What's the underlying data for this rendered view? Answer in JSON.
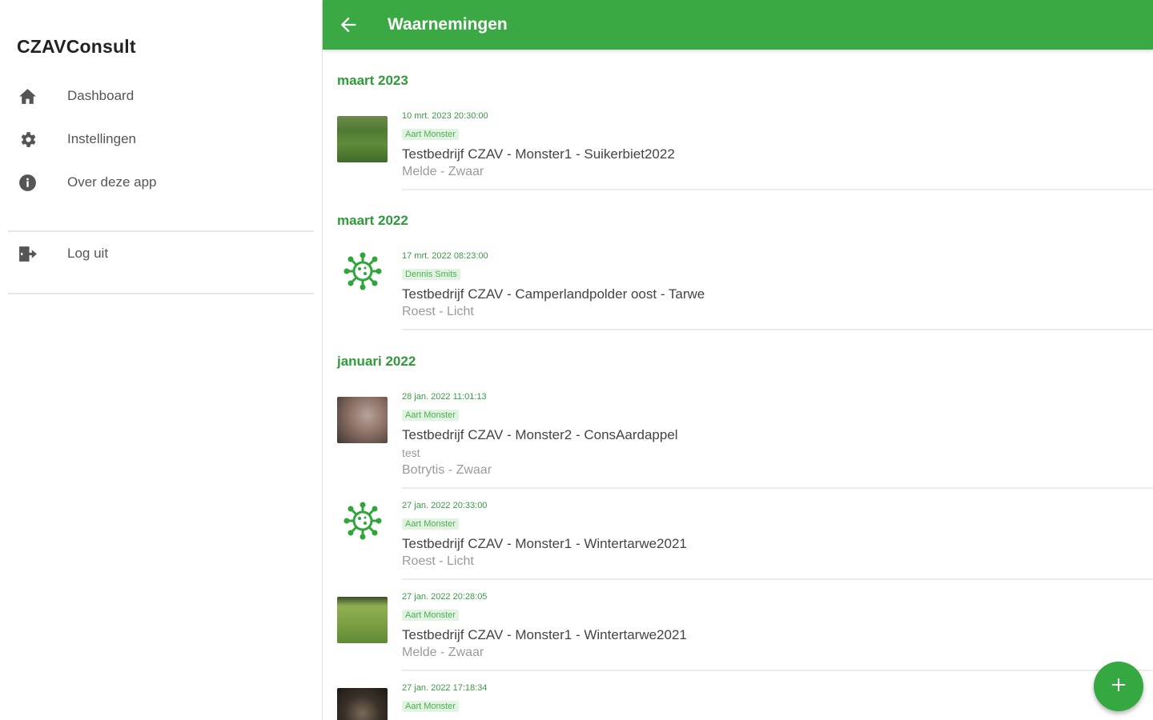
{
  "app": {
    "title": "CZAVConsult"
  },
  "sidebar": {
    "items": [
      {
        "label": "Dashboard",
        "icon": "home-icon"
      },
      {
        "label": "Instellingen",
        "icon": "gear-icon"
      },
      {
        "label": "Over deze app",
        "icon": "info-icon"
      }
    ],
    "logout": {
      "label": "Log uit",
      "icon": "logout-icon"
    }
  },
  "header": {
    "title": "Waarnemingen"
  },
  "sections": [
    {
      "heading": "maart 2023",
      "items": [
        {
          "date": "10 mrt. 2023 20:30:00",
          "author": "Aart Monster",
          "title": "Testbedrijf CZAV - Monster1 - Suikerbiet2022",
          "detail": "Melde - Zwaar",
          "thumb": "photo"
        }
      ]
    },
    {
      "heading": "maart 2022",
      "items": [
        {
          "date": "17 mrt. 2022 08:23:00",
          "author": "Dennis Smits",
          "title": "Testbedrijf CZAV - Camperlandpolder oost - Tarwe",
          "detail": "Roest - Licht",
          "thumb": "virus-icon"
        }
      ]
    },
    {
      "heading": "januari 2022",
      "items": [
        {
          "date": "28 jan. 2022 11:01:13",
          "author": "Aart Monster",
          "title": "Testbedrijf CZAV - Monster2 - ConsAardappel",
          "note": "test",
          "detail": "Botrytis - Zwaar",
          "thumb": "photo"
        },
        {
          "date": "27 jan. 2022 20:33:00",
          "author": "Aart Monster",
          "title": "Testbedrijf CZAV - Monster1 - Wintertarwe2021",
          "detail": "Roest - Licht",
          "thumb": "virus-icon"
        },
        {
          "date": "27 jan. 2022 20:28:05",
          "author": "Aart Monster",
          "title": "Testbedrijf CZAV - Monster1 - Wintertarwe2021",
          "detail": "Melde - Zwaar",
          "thumb": "photo"
        },
        {
          "date": "27 jan. 2022 17:18:34",
          "author": "Aart Monster",
          "title": "",
          "detail": "",
          "thumb": "photo"
        }
      ]
    }
  ],
  "colors": {
    "primary": "#3aa843",
    "accent": "#2e9b3a"
  }
}
